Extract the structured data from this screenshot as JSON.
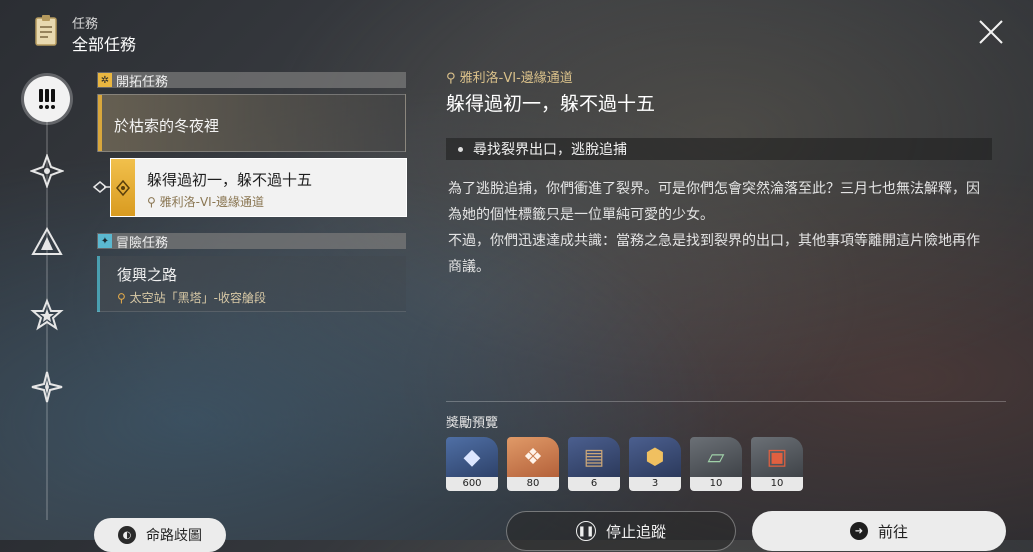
{
  "header": {
    "category": "任務",
    "title": "全部任務"
  },
  "rail": {
    "items": [
      "all-quests",
      "trailblaze",
      "companion",
      "adventure",
      "daily"
    ]
  },
  "sections": {
    "trailblaze": {
      "label": "開拓任務"
    },
    "adventure": {
      "label": "冒險任務"
    }
  },
  "quests": {
    "main": {
      "title": "於枯索的冬夜裡"
    },
    "selected": {
      "title": "躲得過初一，躲不過十五",
      "location": "雅利洛-VI-邊緣通道"
    },
    "adventure": {
      "title": "復興之路",
      "location": "太空站「黑塔」-收容艙段"
    }
  },
  "detail": {
    "location": "雅利洛-VI-邊緣通道",
    "title": "躲得過初一，躲不過十五",
    "objective": "尋找裂界出口，逃脫追捕",
    "paragraphs": [
      "為了逃脫追捕，你們衝進了裂界。可是你們怎會突然淪落至此？三月七也無法解釋，因為她的個性標籤只是一位單純可愛的少女。",
      "不過，你們迅速達成共識：當務之急是找到裂界的出口，其他事項等離開這片險地再作商議。"
    ]
  },
  "rewards": {
    "label": "獎勵預覽",
    "items": [
      {
        "icon": "stellar-jade-icon",
        "count": "600",
        "color": "#3c5a86"
      },
      {
        "icon": "crystal-icon",
        "count": "80",
        "color": "#c77b4a"
      },
      {
        "icon": "book-icon",
        "count": "6",
        "color": "#3a4d78"
      },
      {
        "icon": "lightcone-icon",
        "count": "3",
        "color": "#3a4d78"
      },
      {
        "icon": "map-material-icon",
        "count": "10",
        "color": "#555a60"
      },
      {
        "icon": "relic-box-icon",
        "count": "10",
        "color": "#555a60"
      }
    ]
  },
  "buttons": {
    "map": "命路歧圖",
    "stop": "停止追蹤",
    "go": "前往"
  }
}
